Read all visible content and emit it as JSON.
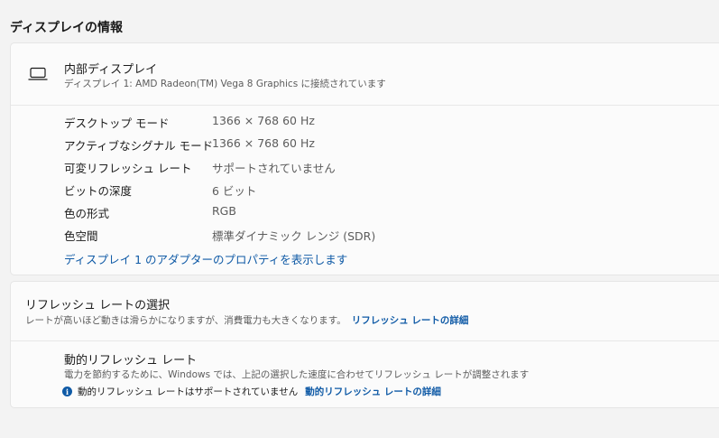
{
  "section_title": "ディスプレイの情報",
  "display": {
    "icon": "laptop-icon",
    "name": "内部ディスプレイ",
    "subtitle": "ディスプレイ 1: AMD Radeon(TM) Vega 8 Graphics に接続されています",
    "specs": [
      {
        "label": "デスクトップ モード",
        "value": "1366 × 768 60 Hz"
      },
      {
        "label": "アクティブなシグナル モード",
        "value": "1366 × 768 60 Hz"
      },
      {
        "label": "可変リフレッシュ レート",
        "value": "サポートされていません"
      },
      {
        "label": "ビットの深度",
        "value": "6 ビット"
      },
      {
        "label": "色の形式",
        "value": "RGB"
      },
      {
        "label": "色空間",
        "value": "標準ダイナミック レンジ (SDR)"
      }
    ],
    "adapter_link": "ディスプレイ 1 のアダプターのプロパティを表示します"
  },
  "refresh": {
    "title": "リフレッシュ レートの選択",
    "description": "レートが高いほど動きは滑らかになりますが、消費電力も大きくなります。",
    "details_link": "リフレッシュ レートの詳細",
    "dynamic": {
      "title": "動的リフレッシュ レート",
      "description": "電力を節約するために、Windows では、上記の選択した速度に合わせてリフレッシュ レートが調整されます",
      "info_text": "動的リフレッシュ レートはサポートされていません",
      "info_link": "動的リフレッシュ レートの詳細"
    }
  },
  "colors": {
    "accent": "#0f5aa6",
    "background": "#f3f3f3",
    "card": "#fbfbfb"
  }
}
